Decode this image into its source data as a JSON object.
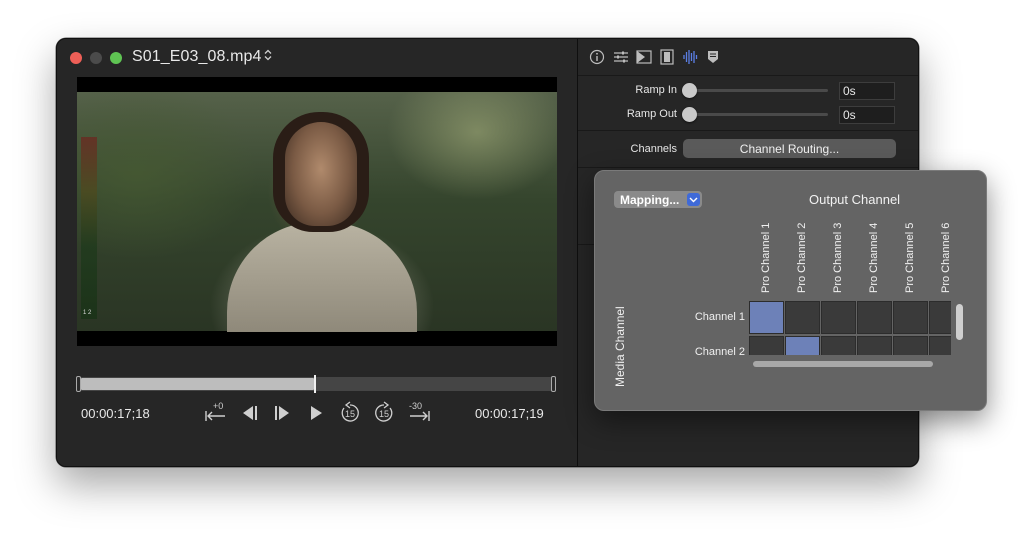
{
  "window": {
    "title": "S01_E03_08.mp4",
    "title_chevron": "⌃⌄"
  },
  "player": {
    "meter_label": "1 2",
    "timecode_current": "00:00:17;18",
    "timecode_end": "00:00:17;19",
    "progress": 0.495,
    "controls": {
      "nudge_forward_label": "+0",
      "replay_15_label": "15",
      "forward_15_label": "15",
      "jump_back_label": "-30"
    }
  },
  "inspector": {
    "ramp_in_label": "Ramp In",
    "ramp_in_value": "0s",
    "ramp_out_label": "Ramp Out",
    "ramp_out_value": "0s",
    "channels_label": "Channels",
    "channel_routing_button": "Channel Routing..."
  },
  "routing": {
    "mapping_button": "Mapping...",
    "output_title": "Output Channel",
    "media_title": "Media Channel",
    "output_channels": [
      "Pro Channel 1",
      "Pro Channel 2",
      "Pro Channel 3",
      "Pro Channel 4",
      "Pro Channel 5",
      "Pro Channel 6"
    ],
    "media_channels": [
      "Channel 1",
      "Channel 2"
    ],
    "matrix": [
      [
        1,
        0,
        0,
        0,
        0,
        0
      ],
      [
        0,
        1,
        0,
        0,
        0,
        0
      ]
    ],
    "accent_color": "#6d81b8"
  }
}
